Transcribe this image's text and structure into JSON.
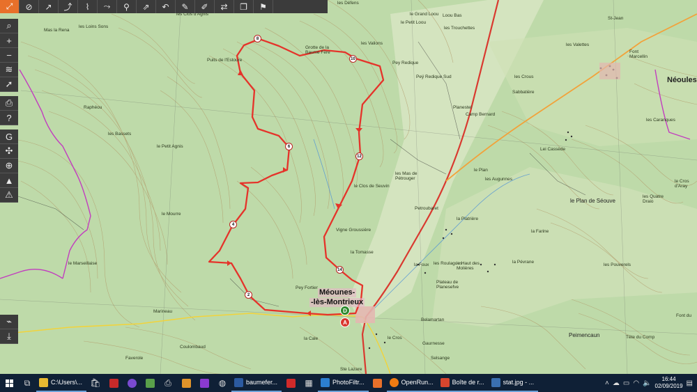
{
  "map": {
    "towns": {
      "meounes_1": "Méounes-",
      "meounes_2": "-lès-Montrieux",
      "neoules": "Néoules"
    },
    "labels": {
      "clos_dagnis": "les Clos d'Agnis",
      "loins_sons": "les Loins Sons",
      "mas_la_rena": "Mas la Rena",
      "rapheou": "Raphéou",
      "bassets": "les Bassets",
      "petit_agnis": "le Petit Agnis",
      "marseillaise": "le Marseillaise",
      "mourre": "le Mourre",
      "defens": "les Défens",
      "grand_loou": "le Grand Loou",
      "petit_loou": "le Petit Loou",
      "loou_bas": "Loou Bas",
      "trouchettes": "les Trouchettes",
      "valions": "les Valions",
      "pey_redique": "Pey Redique",
      "pey_redique_sud": "Peÿ Redique Sud",
      "grotte": "Grotte de la Baume Fère",
      "planestel": "Planestel",
      "camp_bernard": "Camp Bernard",
      "le_plan": "le Plan",
      "clos_de_seuvin": "le Clos de Seuvin",
      "mas_de_petrouger": "les Mas de Pétrouger",
      "petroubaret": "Petroubaret",
      "vigne_groussiere": "Vigne Groussière",
      "la_tomasse": "la Tomasse",
      "la_foux": "la Foux",
      "haut_des_molieres": "le Haut des Molières",
      "plateau_de_planesefve": "Plateau de Planesefve",
      "pey_fortier": "Pey Fortier",
      "belamartan": "Belamartan",
      "gaurnesse": "Gaurnesse",
      "selsange": "Selsange",
      "la_cale": "la Cale",
      "coulombaud": "Coulombaud",
      "faverole": "Faverole",
      "sainte_lazare": "Ste Lazare",
      "peimencaun": "Peimencaun",
      "tete_du_comp": "Tête du Comp",
      "le_plan_de_seouve": "le Plan de Séouve",
      "lei_cassede": "Lei Cassède",
      "les_valettes": "les Valettes",
      "font_marcellin": "Font Marcellin",
      "les_caranques": "les Caranques",
      "la_platriere": "la Platrière",
      "les_augunnes": "les Augunnes",
      "les_quatre_draio": "les Quatre Draio",
      "le_cros_daray": "le Cros d'Aray",
      "les_pouverels": "les Pouverels",
      "la_farine": "la Farine",
      "font_du": "Font du",
      "st_jean": "St-Jean",
      "sabbatiere": "Sabbatière",
      "le_crous": "les Crous",
      "les_roulagues": "les Roulagues",
      "les_cros": "le Cros",
      "la_pevrane": "la Pévrane",
      "marineau": "Marineau",
      "puits_de_lestoure": "Puits de l'Estoure"
    },
    "waypoints": [
      "2",
      "4",
      "6",
      "8",
      "10",
      "12",
      "14"
    ],
    "start_marker": "D",
    "end_marker": "A",
    "route_color": "#e5332a",
    "road_color": "#d9392f"
  },
  "toolbar": {
    "top_icons": [
      "expand-icon",
      "hide-icon",
      "route-icon",
      "route-icon",
      "route-icon",
      "route-icon",
      "bike-icon",
      "route-icon",
      "undo-icon",
      "draw-icon",
      "draw-icon",
      "swap-icon",
      "copy-icon",
      "pin-icon"
    ],
    "left_icons": [
      "search-icon",
      "zoom-in-icon",
      "zoom-out-icon",
      "layers-icon",
      "locate-icon",
      "print-icon",
      "help-icon",
      "gps-icon",
      "compass-icon",
      "globe-icon",
      "terrain-icon",
      "hazard-icon"
    ],
    "left_icons_bottom": [
      "chart-icon",
      "download-icon"
    ]
  },
  "taskbar": {
    "apps": [
      {
        "label": "C:\\Users\\...",
        "color": "#e8b931"
      },
      {
        "label": "baumefer...",
        "color": "#2c5aa0"
      },
      {
        "label": "PhotoFiltr...",
        "color": "#2c7fd0"
      },
      {
        "label": "OpenRun...",
        "color": "#f07b12"
      },
      {
        "label": "Boîte de r...",
        "color": "#d8452e"
      },
      {
        "label": "stat.jpg - ...",
        "color": "#3a6fb0"
      }
    ],
    "time": "16:44",
    "date": "02/09/2019"
  }
}
